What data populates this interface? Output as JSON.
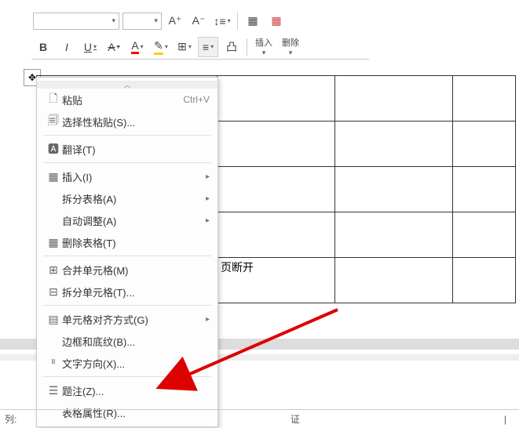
{
  "toolbar": {
    "font_inc": "A⁺",
    "font_dec": "A⁻",
    "bold": "B",
    "italic": "I",
    "underline": "U",
    "strike": "A",
    "font_color": "A",
    "insert_label": "插入",
    "delete_label": "删除"
  },
  "context_menu": {
    "paste": "粘贴",
    "paste_shortcut": "Ctrl+V",
    "paste_special": "选择性粘贴(S)...",
    "translate": "翻译(T)",
    "insert": "插入(I)",
    "split_table": "拆分表格(A)",
    "auto_fit": "自动调整(A)",
    "delete_table": "删除表格(T)",
    "merge_cells": "合并单元格(M)",
    "split_cells": "拆分单元格(T)...",
    "cell_align": "单元格对齐方式(G)",
    "borders": "边框和底纹(B)...",
    "text_direction": "文字方向(X)...",
    "caption": "题注(Z)...",
    "table_props": "表格属性(R)..."
  },
  "table": {
    "cell_r5_c2": "页断开"
  },
  "statusbar": {
    "col_label": "列:",
    "verify": "证"
  }
}
